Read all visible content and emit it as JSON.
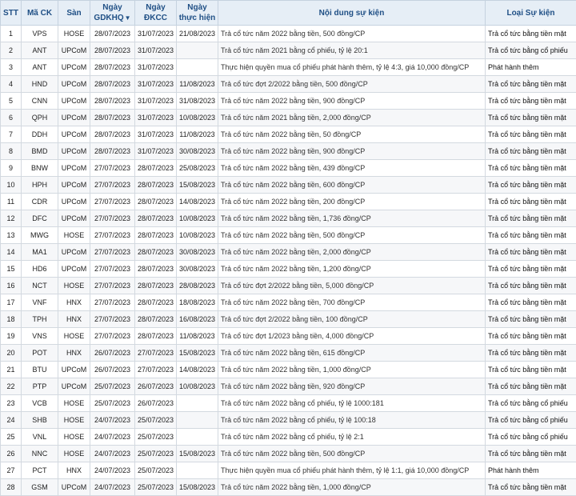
{
  "table": {
    "headers": {
      "stt": "STT",
      "ma": "Mã CK",
      "san": "Sàn",
      "gdkhq": "Ngày GDKHQ",
      "gdkhq_sort_icon": "sort-down-triangle",
      "dkcc": "Ngày ĐKCC",
      "thuchien": "Ngày thực hiện",
      "noidung": "Nội dung sự kiện",
      "loai": "Loại Sự kiện"
    },
    "rows": [
      {
        "stt": "1",
        "ma": "VPS",
        "san": "HOSE",
        "gdkhq": "28/07/2023",
        "dkcc": "31/07/2023",
        "thuchien": "21/08/2023",
        "noidung": "Trả cổ tức năm 2022 bằng tiền, 500 đồng/CP",
        "loai": "Trả cổ tức bằng tiền mặt"
      },
      {
        "stt": "2",
        "ma": "ANT",
        "san": "UPCoM",
        "gdkhq": "28/07/2023",
        "dkcc": "31/07/2023",
        "thuchien": "",
        "noidung": "Trả cổ tức năm 2021 bằng cổ phiếu, tỷ lệ 20:1",
        "loai": "Trả cổ tức bằng cổ phiếu"
      },
      {
        "stt": "3",
        "ma": "ANT",
        "san": "UPCoM",
        "gdkhq": "28/07/2023",
        "dkcc": "31/07/2023",
        "thuchien": "",
        "noidung": "Thực hiện quyền mua cổ phiếu phát hành thêm, tỷ lệ 4:3, giá 10,000 đồng/CP",
        "loai": "Phát hành thêm"
      },
      {
        "stt": "4",
        "ma": "HND",
        "san": "UPCoM",
        "gdkhq": "28/07/2023",
        "dkcc": "31/07/2023",
        "thuchien": "11/08/2023",
        "noidung": "Trả cổ tức đợt 2/2022 bằng tiền, 500 đồng/CP",
        "loai": "Trả cổ tức bằng tiền mặt"
      },
      {
        "stt": "5",
        "ma": "CNN",
        "san": "UPCoM",
        "gdkhq": "28/07/2023",
        "dkcc": "31/07/2023",
        "thuchien": "31/08/2023",
        "noidung": "Trả cổ tức năm 2022 bằng tiền, 900 đồng/CP",
        "loai": "Trả cổ tức bằng tiền mặt"
      },
      {
        "stt": "6",
        "ma": "QPH",
        "san": "UPCoM",
        "gdkhq": "28/07/2023",
        "dkcc": "31/07/2023",
        "thuchien": "10/08/2023",
        "noidung": "Trả cổ tức năm 2021 bằng tiền, 2,000 đồng/CP",
        "loai": "Trả cổ tức bằng tiền mặt"
      },
      {
        "stt": "7",
        "ma": "DDH",
        "san": "UPCoM",
        "gdkhq": "28/07/2023",
        "dkcc": "31/07/2023",
        "thuchien": "11/08/2023",
        "noidung": "Trả cổ tức năm 2022 bằng tiền, 50 đồng/CP",
        "loai": "Trả cổ tức bằng tiền mặt"
      },
      {
        "stt": "8",
        "ma": "BMD",
        "san": "UPCoM",
        "gdkhq": "28/07/2023",
        "dkcc": "31/07/2023",
        "thuchien": "30/08/2023",
        "noidung": "Trả cổ tức năm 2022 bằng tiền, 900 đồng/CP",
        "loai": "Trả cổ tức bằng tiền mặt"
      },
      {
        "stt": "9",
        "ma": "BNW",
        "san": "UPCoM",
        "gdkhq": "27/07/2023",
        "dkcc": "28/07/2023",
        "thuchien": "25/08/2023",
        "noidung": "Trả cổ tức năm 2022 bằng tiền, 439 đồng/CP",
        "loai": "Trả cổ tức bằng tiền mặt"
      },
      {
        "stt": "10",
        "ma": "HPH",
        "san": "UPCoM",
        "gdkhq": "27/07/2023",
        "dkcc": "28/07/2023",
        "thuchien": "15/08/2023",
        "noidung": "Trả cổ tức năm 2022 bằng tiền, 600 đồng/CP",
        "loai": "Trả cổ tức bằng tiền mặt"
      },
      {
        "stt": "11",
        "ma": "CDR",
        "san": "UPCoM",
        "gdkhq": "27/07/2023",
        "dkcc": "28/07/2023",
        "thuchien": "14/08/2023",
        "noidung": "Trả cổ tức năm 2022 bằng tiền, 200 đồng/CP",
        "loai": "Trả cổ tức bằng tiền mặt"
      },
      {
        "stt": "12",
        "ma": "DFC",
        "san": "UPCoM",
        "gdkhq": "27/07/2023",
        "dkcc": "28/07/2023",
        "thuchien": "10/08/2023",
        "noidung": "Trả cổ tức năm 2022 bằng tiền, 1,736 đồng/CP",
        "loai": "Trả cổ tức bằng tiền mặt"
      },
      {
        "stt": "13",
        "ma": "MWG",
        "san": "HOSE",
        "gdkhq": "27/07/2023",
        "dkcc": "28/07/2023",
        "thuchien": "10/08/2023",
        "noidung": "Trả cổ tức năm 2022 bằng tiền, 500 đồng/CP",
        "loai": "Trả cổ tức bằng tiền mặt"
      },
      {
        "stt": "14",
        "ma": "MA1",
        "san": "UPCoM",
        "gdkhq": "27/07/2023",
        "dkcc": "28/07/2023",
        "thuchien": "30/08/2023",
        "noidung": "Trả cổ tức năm 2022 bằng tiền, 2,000 đồng/CP",
        "loai": "Trả cổ tức bằng tiền mặt"
      },
      {
        "stt": "15",
        "ma": "HD6",
        "san": "UPCoM",
        "gdkhq": "27/07/2023",
        "dkcc": "28/07/2023",
        "thuchien": "30/08/2023",
        "noidung": "Trả cổ tức năm 2022 bằng tiền, 1,200 đồng/CP",
        "loai": "Trả cổ tức bằng tiền mặt"
      },
      {
        "stt": "16",
        "ma": "NCT",
        "san": "HOSE",
        "gdkhq": "27/07/2023",
        "dkcc": "28/07/2023",
        "thuchien": "28/08/2023",
        "noidung": "Trả cổ tức đợt 2/2022 bằng tiền, 5,000 đồng/CP",
        "loai": "Trả cổ tức bằng tiền mặt"
      },
      {
        "stt": "17",
        "ma": "VNF",
        "san": "HNX",
        "gdkhq": "27/07/2023",
        "dkcc": "28/07/2023",
        "thuchien": "18/08/2023",
        "noidung": "Trả cổ tức năm 2022 bằng tiền, 700 đồng/CP",
        "loai": "Trả cổ tức bằng tiền mặt"
      },
      {
        "stt": "18",
        "ma": "TPH",
        "san": "HNX",
        "gdkhq": "27/07/2023",
        "dkcc": "28/07/2023",
        "thuchien": "16/08/2023",
        "noidung": "Trả cổ tức đợt 2/2022 bằng tiền, 100 đồng/CP",
        "loai": "Trả cổ tức bằng tiền mặt"
      },
      {
        "stt": "19",
        "ma": "VNS",
        "san": "HOSE",
        "gdkhq": "27/07/2023",
        "dkcc": "28/07/2023",
        "thuchien": "11/08/2023",
        "noidung": "Trả cổ tức đợt 1/2023 bằng tiền, 4,000 đồng/CP",
        "loai": "Trả cổ tức bằng tiền mặt"
      },
      {
        "stt": "20",
        "ma": "POT",
        "san": "HNX",
        "gdkhq": "26/07/2023",
        "dkcc": "27/07/2023",
        "thuchien": "15/08/2023",
        "noidung": "Trả cổ tức năm 2022 bằng tiền, 615 đồng/CP",
        "loai": "Trả cổ tức bằng tiền mặt"
      },
      {
        "stt": "21",
        "ma": "BTU",
        "san": "UPCoM",
        "gdkhq": "26/07/2023",
        "dkcc": "27/07/2023",
        "thuchien": "14/08/2023",
        "noidung": "Trả cổ tức năm 2022 bằng tiền, 1,000 đồng/CP",
        "loai": "Trả cổ tức bằng tiền mặt"
      },
      {
        "stt": "22",
        "ma": "PTP",
        "san": "UPCoM",
        "gdkhq": "25/07/2023",
        "dkcc": "26/07/2023",
        "thuchien": "10/08/2023",
        "noidung": "Trả cổ tức năm 2022 bằng tiền, 920 đồng/CP",
        "loai": "Trả cổ tức bằng tiền mặt"
      },
      {
        "stt": "23",
        "ma": "VCB",
        "san": "HOSE",
        "gdkhq": "25/07/2023",
        "dkcc": "26/07/2023",
        "thuchien": "",
        "noidung": "Trả cổ tức năm 2022 bằng cổ phiếu, tỷ lệ 1000:181",
        "loai": "Trả cổ tức bằng cổ phiếu"
      },
      {
        "stt": "24",
        "ma": "SHB",
        "san": "HOSE",
        "gdkhq": "24/07/2023",
        "dkcc": "25/07/2023",
        "thuchien": "",
        "noidung": "Trả cổ tức năm 2022 bằng cổ phiếu, tỷ lệ 100:18",
        "loai": "Trả cổ tức bằng cổ phiếu"
      },
      {
        "stt": "25",
        "ma": "VNL",
        "san": "HOSE",
        "gdkhq": "24/07/2023",
        "dkcc": "25/07/2023",
        "thuchien": "",
        "noidung": "Trả cổ tức năm 2022 bằng cổ phiếu, tỷ lệ 2:1",
        "loai": "Trả cổ tức bằng cổ phiếu"
      },
      {
        "stt": "26",
        "ma": "NNC",
        "san": "HOSE",
        "gdkhq": "24/07/2023",
        "dkcc": "25/07/2023",
        "thuchien": "15/08/2023",
        "noidung": "Trả cổ tức năm 2022 bằng tiền, 500 đồng/CP",
        "loai": "Trả cổ tức bằng tiền mặt"
      },
      {
        "stt": "27",
        "ma": "PCT",
        "san": "HNX",
        "gdkhq": "24/07/2023",
        "dkcc": "25/07/2023",
        "thuchien": "",
        "noidung": "Thực hiện quyền mua cổ phiếu phát hành thêm, tỷ lệ 1:1, giá 10,000 đồng/CP",
        "loai": "Phát hành thêm"
      },
      {
        "stt": "28",
        "ma": "GSM",
        "san": "UPCoM",
        "gdkhq": "24/07/2023",
        "dkcc": "25/07/2023",
        "thuchien": "15/08/2023",
        "noidung": "Trả cổ tức năm 2022 bằng tiền, 1,000 đồng/CP",
        "loai": "Trả cổ tức bằng tiền mặt"
      }
    ]
  }
}
